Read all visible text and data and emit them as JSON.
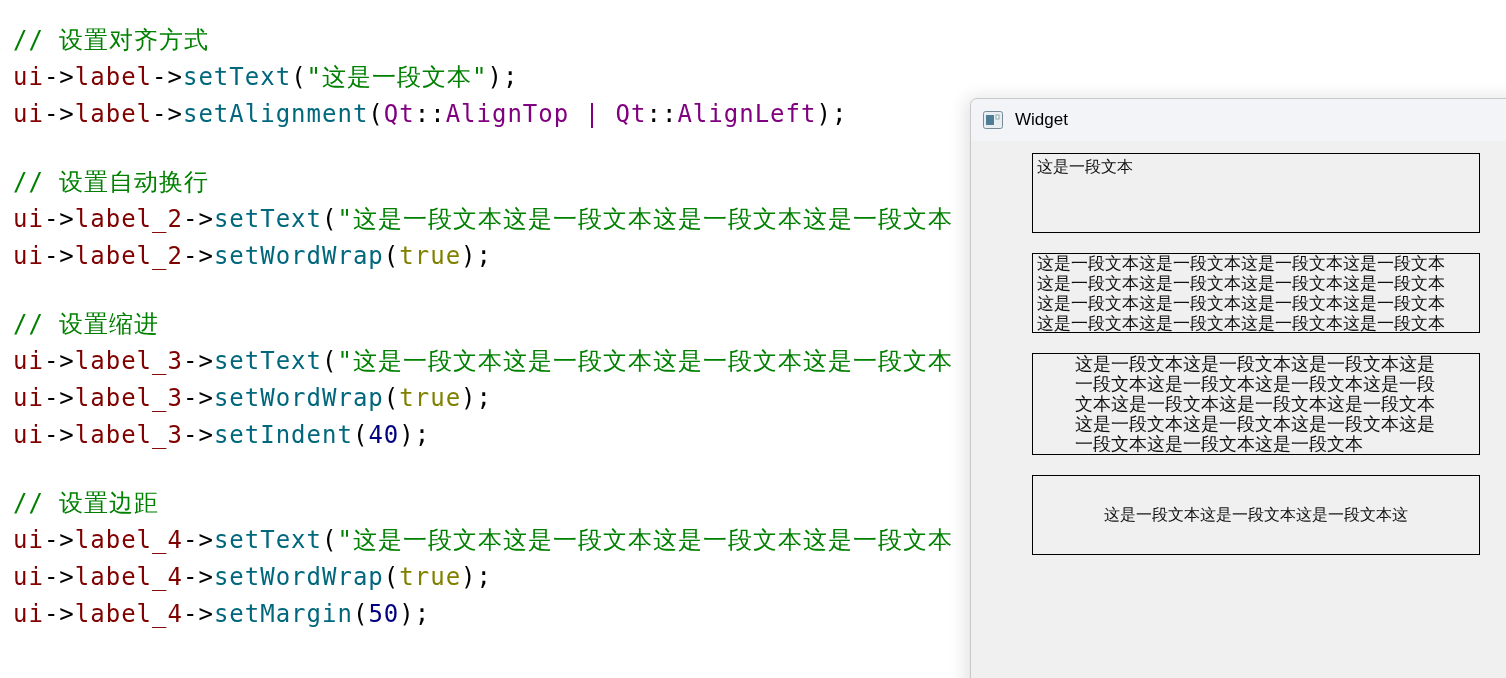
{
  "code": {
    "blocks": [
      {
        "lines": [
          [
            {
              "kind": "comment",
              "text": "// 设置对齐方式"
            }
          ],
          [
            {
              "kind": "object",
              "text": "ui"
            },
            {
              "kind": "punct",
              "text": "->"
            },
            {
              "kind": "object",
              "text": "label"
            },
            {
              "kind": "punct",
              "text": "->"
            },
            {
              "kind": "method",
              "text": "setText"
            },
            {
              "kind": "punct",
              "text": "("
            },
            {
              "kind": "string",
              "text": "\"这是一段文本\""
            },
            {
              "kind": "punct",
              "text": ");"
            }
          ],
          [
            {
              "kind": "object",
              "text": "ui"
            },
            {
              "kind": "punct",
              "text": "->"
            },
            {
              "kind": "object",
              "text": "label"
            },
            {
              "kind": "punct",
              "text": "->"
            },
            {
              "kind": "method",
              "text": "setAlignment"
            },
            {
              "kind": "punct",
              "text": "("
            },
            {
              "kind": "enum",
              "text": "Qt"
            },
            {
              "kind": "punct",
              "text": "::"
            },
            {
              "kind": "enum",
              "text": "AlignTop"
            },
            {
              "kind": "enum",
              "text": " | "
            },
            {
              "kind": "enum",
              "text": "Qt"
            },
            {
              "kind": "punct",
              "text": "::"
            },
            {
              "kind": "enum",
              "text": "AlignLeft"
            },
            {
              "kind": "punct",
              "text": ");"
            }
          ]
        ]
      },
      {
        "lines": [
          [
            {
              "kind": "comment",
              "text": "// 设置自动换行"
            }
          ],
          [
            {
              "kind": "object",
              "text": "ui"
            },
            {
              "kind": "punct",
              "text": "->"
            },
            {
              "kind": "object",
              "text": "label_2"
            },
            {
              "kind": "punct",
              "text": "->"
            },
            {
              "kind": "method",
              "text": "setText"
            },
            {
              "kind": "punct",
              "text": "("
            },
            {
              "kind": "string",
              "text": "\"这是一段文本这是一段文本这是一段文本这是一段文本"
            }
          ],
          [
            {
              "kind": "object",
              "text": "ui"
            },
            {
              "kind": "punct",
              "text": "->"
            },
            {
              "kind": "object",
              "text": "label_2"
            },
            {
              "kind": "punct",
              "text": "->"
            },
            {
              "kind": "method",
              "text": "setWordWrap"
            },
            {
              "kind": "punct",
              "text": "("
            },
            {
              "kind": "keyword",
              "text": "true"
            },
            {
              "kind": "punct",
              "text": ");"
            }
          ]
        ]
      },
      {
        "lines": [
          [
            {
              "kind": "comment",
              "text": "// 设置缩进"
            }
          ],
          [
            {
              "kind": "object",
              "text": "ui"
            },
            {
              "kind": "punct",
              "text": "->"
            },
            {
              "kind": "object",
              "text": "label_3"
            },
            {
              "kind": "punct",
              "text": "->"
            },
            {
              "kind": "method",
              "text": "setText"
            },
            {
              "kind": "punct",
              "text": "("
            },
            {
              "kind": "string",
              "text": "\"这是一段文本这是一段文本这是一段文本这是一段文本"
            }
          ],
          [
            {
              "kind": "object",
              "text": "ui"
            },
            {
              "kind": "punct",
              "text": "->"
            },
            {
              "kind": "object",
              "text": "label_3"
            },
            {
              "kind": "punct",
              "text": "->"
            },
            {
              "kind": "method",
              "text": "setWordWrap"
            },
            {
              "kind": "punct",
              "text": "("
            },
            {
              "kind": "keyword",
              "text": "true"
            },
            {
              "kind": "punct",
              "text": ");"
            }
          ],
          [
            {
              "kind": "object",
              "text": "ui"
            },
            {
              "kind": "punct",
              "text": "->"
            },
            {
              "kind": "object",
              "text": "label_3"
            },
            {
              "kind": "punct",
              "text": "->"
            },
            {
              "kind": "method",
              "text": "setIndent"
            },
            {
              "kind": "punct",
              "text": "("
            },
            {
              "kind": "number",
              "text": "40"
            },
            {
              "kind": "punct",
              "text": ");"
            }
          ]
        ]
      },
      {
        "lines": [
          [
            {
              "kind": "comment",
              "text": "// 设置边距"
            }
          ],
          [
            {
              "kind": "object",
              "text": "ui"
            },
            {
              "kind": "punct",
              "text": "->"
            },
            {
              "kind": "object",
              "text": "label_4"
            },
            {
              "kind": "punct",
              "text": "->"
            },
            {
              "kind": "method",
              "text": "setText"
            },
            {
              "kind": "punct",
              "text": "("
            },
            {
              "kind": "string",
              "text": "\"这是一段文本这是一段文本这是一段文本这是一段文本"
            }
          ],
          [
            {
              "kind": "object",
              "text": "ui"
            },
            {
              "kind": "punct",
              "text": "->"
            },
            {
              "kind": "object",
              "text": "label_4"
            },
            {
              "kind": "punct",
              "text": "->"
            },
            {
              "kind": "method",
              "text": "setWordWrap"
            },
            {
              "kind": "punct",
              "text": "("
            },
            {
              "kind": "keyword",
              "text": "true"
            },
            {
              "kind": "punct",
              "text": ");"
            }
          ],
          [
            {
              "kind": "object",
              "text": "ui"
            },
            {
              "kind": "punct",
              "text": "->"
            },
            {
              "kind": "object",
              "text": "label_4"
            },
            {
              "kind": "punct",
              "text": "->"
            },
            {
              "kind": "method",
              "text": "setMargin"
            },
            {
              "kind": "punct",
              "text": "("
            },
            {
              "kind": "number",
              "text": "50"
            },
            {
              "kind": "punct",
              "text": ");"
            }
          ]
        ]
      }
    ]
  },
  "window": {
    "title": "Widget",
    "labels": [
      {
        "kind": "top-left",
        "lines": [
          "这是一段文本"
        ]
      },
      {
        "kind": "wrap",
        "lines": [
          "这是一段文本这是一段文本这是一段文本这是一段文本",
          "这是一段文本这是一段文本这是一段文本这是一段文本",
          "这是一段文本这是一段文本这是一段文本这是一段文本",
          "这是一段文本这是一段文本这是一段文本这是一段文本"
        ]
      },
      {
        "kind": "indent",
        "lines": [
          "这是一段文本这是一段文本这是一段文本这是",
          "一段文本这是一段文本这是一段文本这是一段",
          "文本这是一段文本这是一段文本这是一段文本",
          "这是一段文本这是一段文本这是一段文本这是",
          "一段文本这是一段文本这是一段文本"
        ]
      },
      {
        "kind": "margin",
        "lines": [
          "这是一段文本这是一段文本这是一段文本这"
        ]
      }
    ]
  }
}
